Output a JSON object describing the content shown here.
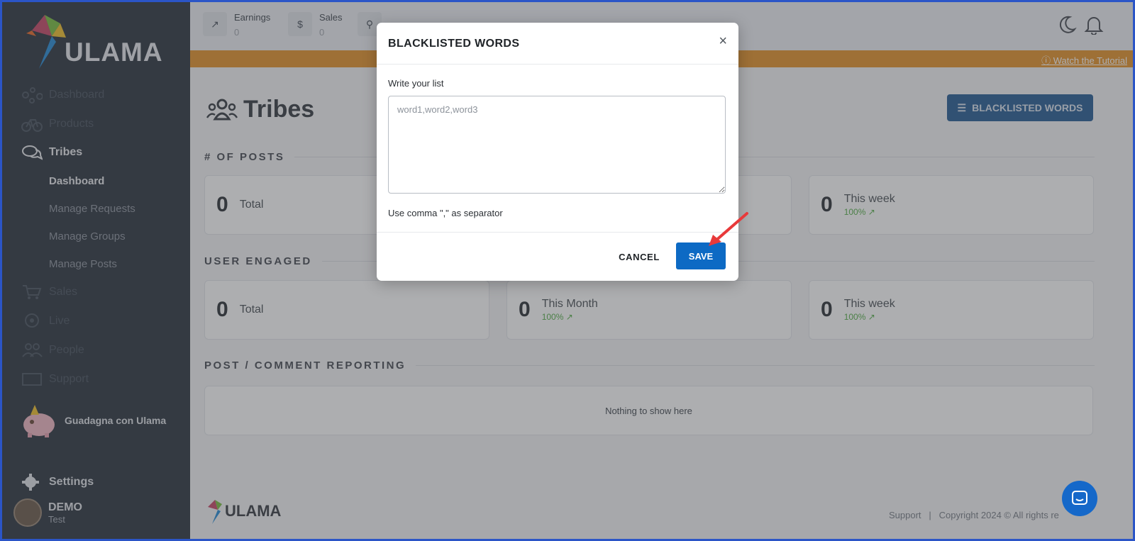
{
  "brand": {
    "name": "ULAMA"
  },
  "sidebar": {
    "items": [
      {
        "label": "Dashboard",
        "icon": "dashboard-icon"
      },
      {
        "label": "Products",
        "icon": "bicycle-icon"
      },
      {
        "label": "Tribes",
        "icon": "chat-bubbles-icon"
      }
    ],
    "tribes_sub": [
      "Dashboard",
      "Manage Requests",
      "Manage Groups",
      "Manage Posts"
    ],
    "items_after": [
      {
        "label": "Sales",
        "icon": "cart-icon"
      },
      {
        "label": "Live",
        "icon": "live-icon"
      },
      {
        "label": "People",
        "icon": "people-icon"
      },
      {
        "label": "Support",
        "icon": "support-icon"
      }
    ],
    "earn_label": "Guadagna con Ulama",
    "settings_label": "Settings",
    "user": {
      "name": "DEMO",
      "subtitle": "Test"
    }
  },
  "topbar": {
    "earnings": {
      "label": "Earnings",
      "value": "0"
    },
    "sales": {
      "label": "Sales",
      "value": "0"
    }
  },
  "banner": {
    "tutorial_link": "Watch the Tutorial"
  },
  "page": {
    "title": "Tribes",
    "blacklist_button": "BLACKLISTED WORDS",
    "sections": {
      "posts": "# OF POSTS",
      "engaged": "USER ENGAGED",
      "reporting": "POST / COMMENT REPORTING"
    },
    "posts_cards": [
      {
        "value": "0",
        "label": "Total"
      },
      {
        "value": "0",
        "label": "This week",
        "trend": "100%"
      }
    ],
    "engaged_cards": [
      {
        "value": "0",
        "label": "Total"
      },
      {
        "value": "0",
        "label": "This Month",
        "trend": "100%"
      },
      {
        "value": "0",
        "label": "This week",
        "trend": "100%"
      }
    ],
    "reporting_empty": "Nothing to show here"
  },
  "footer": {
    "support": "Support",
    "separator": "|",
    "copyright": "Copyright 2024 © All rights re"
  },
  "modal": {
    "title": "BLACKLISTED WORDS",
    "close": "×",
    "field_label": "Write your list",
    "placeholder": "word1,word2,word3",
    "help": "Use comma \",\" as separator",
    "cancel": "CANCEL",
    "save": "SAVE"
  },
  "colors": {
    "sidebar": "#2f3742",
    "banner": "#e6952e",
    "primary": "#0d6ac4",
    "trend": "#58b04c",
    "annotation_arrow": "#e8393a"
  }
}
